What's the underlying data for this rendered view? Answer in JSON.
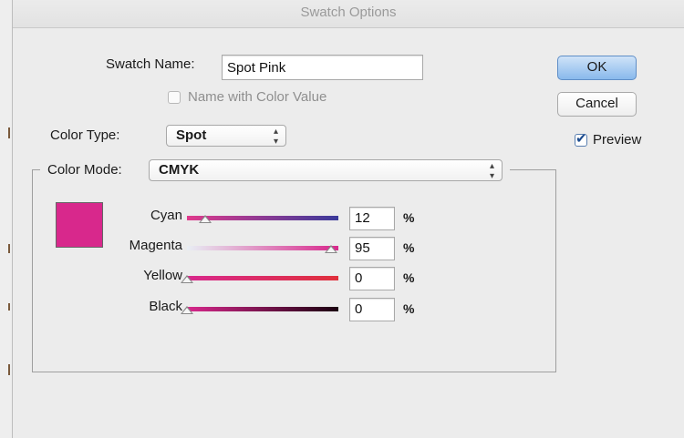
{
  "window": {
    "title": "Swatch Options"
  },
  "swatch_name": {
    "label": "Swatch Name:",
    "value": "Spot Pink"
  },
  "name_with_color_value": {
    "label": "Name with Color Value",
    "checked": false,
    "enabled": false
  },
  "color_type": {
    "label": "Color Type:",
    "value": "Spot"
  },
  "color_mode": {
    "label": "Color Mode:",
    "value": "CMYK"
  },
  "swatch_color": "#d8288c",
  "channels": [
    {
      "label": "Cyan",
      "value": "12",
      "unit": "%",
      "gradient": [
        "#e03a8c",
        "#3a3a9a"
      ],
      "level": 0.12
    },
    {
      "label": "Magenta",
      "value": "95",
      "unit": "%",
      "gradient": [
        "#e8eef4",
        "#d8288c"
      ],
      "level": 0.95
    },
    {
      "label": "Yellow",
      "value": "0",
      "unit": "%",
      "gradient": [
        "#d8288c",
        "#e0303c"
      ],
      "level": 0.0
    },
    {
      "label": "Black",
      "value": "0",
      "unit": "%",
      "gradient": [
        "#d8288c",
        "#1a0010"
      ],
      "level": 0.0
    }
  ],
  "buttons": {
    "ok": "OK",
    "cancel": "Cancel"
  },
  "preview": {
    "label": "Preview",
    "checked": true
  }
}
